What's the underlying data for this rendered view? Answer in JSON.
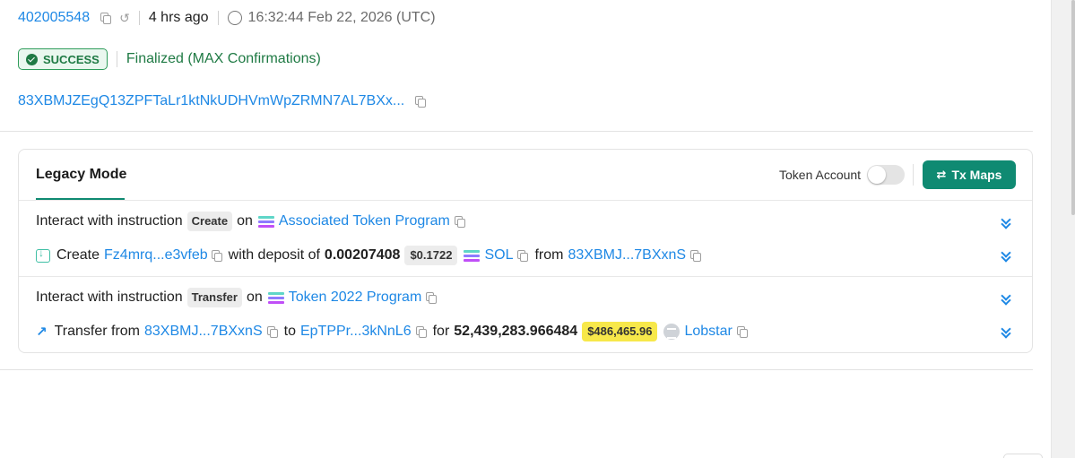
{
  "header": {
    "block": "402005548",
    "age": "4 hrs ago",
    "timestamp": "16:32:44 Feb 22, 2026 (UTC)"
  },
  "status": {
    "badge": "SUCCESS",
    "finality": "Finalized (MAX Confirmations)",
    "badge_color": "#1f7a44"
  },
  "signer": "83XBMJZEgQ13ZPFTaLr1ktNkUDHVmWpZRMN7AL7BXx...",
  "card": {
    "tab": "Legacy Mode",
    "token_account_label": "Token Account",
    "tx_maps_label": "Tx Maps",
    "accent_color": "#0f8a72"
  },
  "instructions": [
    {
      "prefix": "Interact with instruction",
      "type": "Create",
      "on": "on",
      "program": "Associated Token Program",
      "detail": {
        "verb": "Create",
        "account": "Fz4mrq...e3vfeb",
        "mid": "with deposit of",
        "amount": "0.00207408",
        "usd": "$0.1722",
        "token": "SOL",
        "from_word": "from",
        "from": "83XBMJ...7BXxnS"
      }
    },
    {
      "prefix": "Interact with instruction",
      "type": "Transfer",
      "on": "on",
      "program": "Token 2022 Program",
      "detail": {
        "verb": "Transfer from",
        "from": "83XBMJ...7BXxnS",
        "to_word": "to",
        "to": "EpTPPr...3kNnL6",
        "for_word": "for",
        "amount": "52,439,283.966484",
        "usd": "$486,465.96",
        "token": "Lobstar"
      }
    }
  ]
}
